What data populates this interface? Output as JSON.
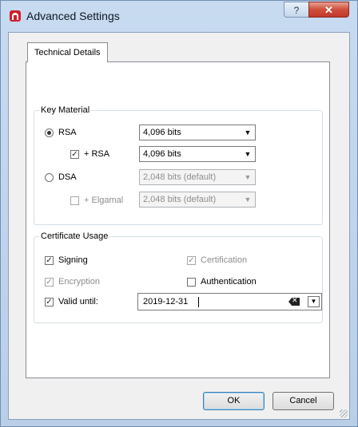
{
  "window": {
    "title": "Advanced Settings",
    "help_label": "?",
    "close_label": "✕"
  },
  "tabs": [
    {
      "label": "Technical Details",
      "selected": true
    }
  ],
  "key_material": {
    "legend": "Key Material",
    "rsa": {
      "label": "RSA",
      "selected": true,
      "size": "4,096 bits"
    },
    "rsa_sub": {
      "label": "+ RSA",
      "checked": true,
      "size": "4,096 bits"
    },
    "dsa": {
      "label": "DSA",
      "selected": false,
      "size": "2,048 bits (default)"
    },
    "elgamal": {
      "label": "+ Elgamal",
      "checked": false,
      "size": "2,048 bits (default)"
    }
  },
  "certificate_usage": {
    "legend": "Certificate Usage",
    "signing": {
      "label": "Signing",
      "checked": true
    },
    "certification": {
      "label": "Certification",
      "checked": true
    },
    "encryption": {
      "label": "Encryption",
      "checked": true
    },
    "authentication": {
      "label": "Authentication",
      "checked": false
    },
    "valid_until": {
      "label": "Valid until:",
      "checked": true,
      "date": "2019-12-31"
    }
  },
  "buttons": {
    "ok": "OK",
    "cancel": "Cancel"
  },
  "icons": {
    "check_mark": "✓",
    "dropdown_arrow": "▼"
  }
}
